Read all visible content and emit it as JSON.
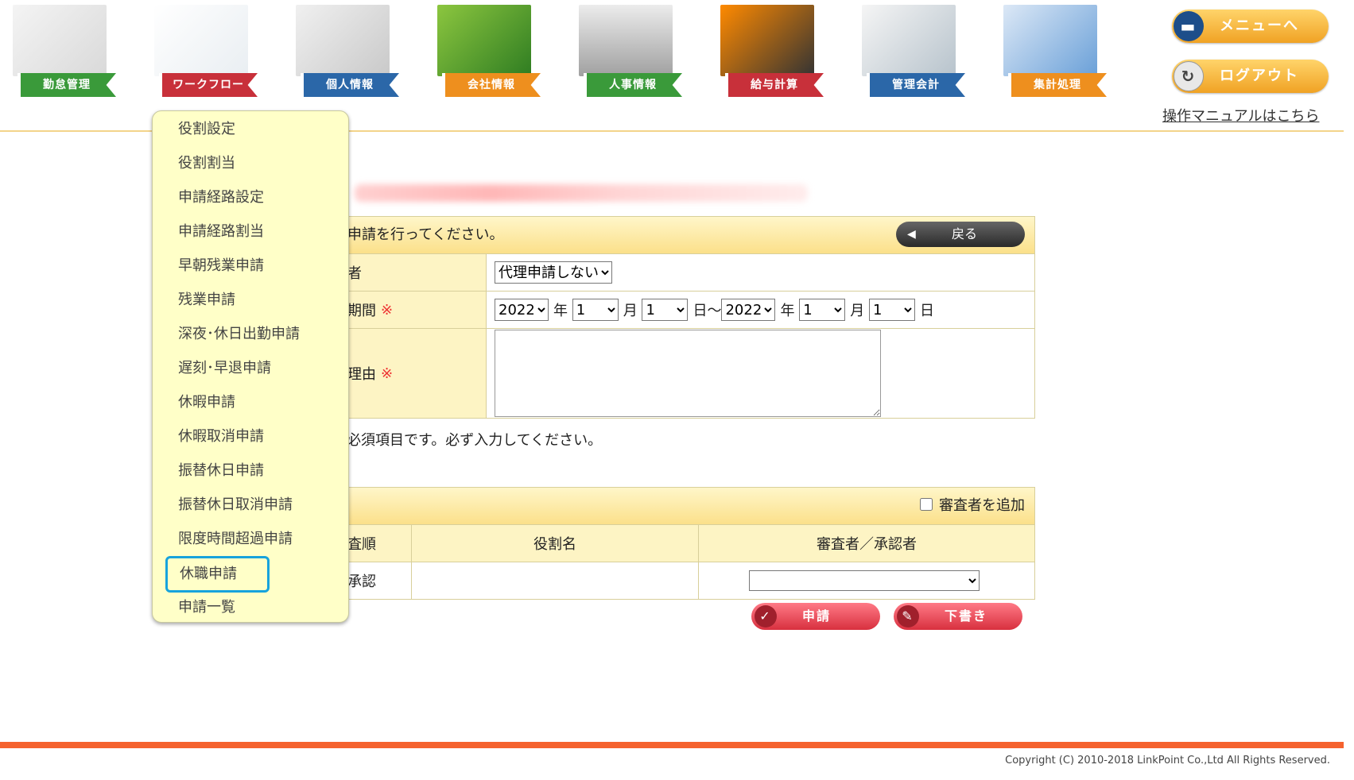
{
  "nav": {
    "tiles": [
      {
        "label": "勤怠管理"
      },
      {
        "label": "ワークフロー"
      },
      {
        "label": "個人情報"
      },
      {
        "label": "会社情報"
      },
      {
        "label": "人事情報"
      },
      {
        "label": "給与計算"
      },
      {
        "label": "管理会計"
      },
      {
        "label": "集計処理"
      }
    ],
    "menu_button": "メニューへ",
    "logout_button": "ログアウト",
    "manual_link": "操作マニュアルはこちら"
  },
  "form": {
    "instruction": "申請を行ってください。",
    "back_button": "戻る",
    "proxy_label": "者",
    "proxy_value": "代理申請しない",
    "period_label": "期間",
    "required_mark": "※",
    "period": {
      "from_year": "2022",
      "year_unit": "年",
      "from_month": "1",
      "month_unit": "月",
      "from_day": "1",
      "day_tilde": "日〜",
      "to_year": "2022",
      "to_month": "1",
      "to_day": "1",
      "day_unit": "日"
    },
    "reason_label": "理由",
    "required_note": "必須項目です。必ず入力してください。"
  },
  "reviewers": {
    "add_reviewer_label": "審査者を追加",
    "columns": [
      "査順",
      "役割名",
      "審査者／承認者"
    ],
    "rows": [
      {
        "order": "承認",
        "role": "",
        "approver": ""
      }
    ],
    "submit_button": "申請",
    "draft_button": "下書き"
  },
  "menu": {
    "items": [
      "役割設定",
      "役割割当",
      "申請経路設定",
      "申請経路割当",
      "早朝残業申請",
      "残業申請",
      "深夜･休日出勤申請",
      "遅刻･早退申請",
      "休暇申請",
      "休暇取消申請",
      "振替休日申請",
      "振替休日取消申請",
      "限度時間超過申請",
      "休職申請",
      "申請一覧"
    ],
    "highlighted_item": "休職申請"
  },
  "footer": {
    "copyright": "Copyright (C) 2010-2018 LinkPoint Co.,Ltd All Rights Reserved."
  },
  "colors": {
    "accent_orange": "#f5622e",
    "menu_bg": "#ffffc8",
    "highlight_border": "#17a3dc",
    "panel_header": "#fbe08a"
  }
}
